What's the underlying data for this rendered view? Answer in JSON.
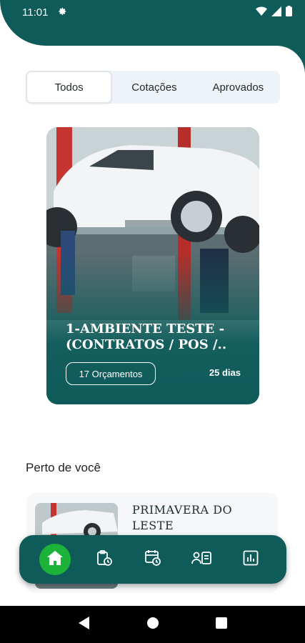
{
  "status_bar": {
    "time": "11:01"
  },
  "tabs": [
    {
      "label": "Todos",
      "active": true
    },
    {
      "label": "Cotações",
      "active": false
    },
    {
      "label": "Aprovados",
      "active": false
    }
  ],
  "featured_card": {
    "title": "1-AMBIENTE TESTE - (CONTRATOS / POS /..",
    "quotes_label": "17 Orçamentos",
    "days_label": "25 dias"
  },
  "nearby": {
    "heading": "Perto de você",
    "items": [
      {
        "name": "PRIMAVERA DO LESTE"
      }
    ]
  },
  "bottom_nav": {
    "items": [
      "home-icon",
      "clipboard-clock-icon",
      "calendar-clock-icon",
      "id-card-icon",
      "bar-chart-icon"
    ],
    "active_index": 0
  },
  "colors": {
    "primary": "#0e5b5a",
    "active_green": "#1db23a",
    "tab_bg": "#eef3fa"
  }
}
